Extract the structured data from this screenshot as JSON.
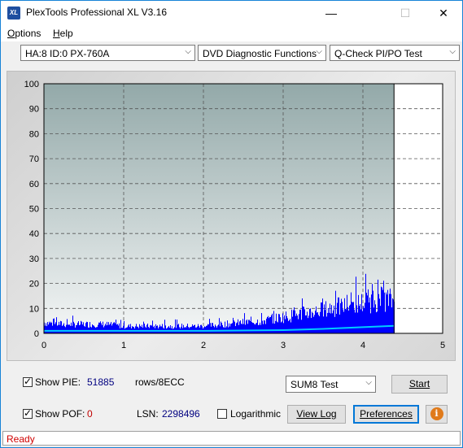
{
  "window": {
    "title": "PlexTools Professional XL V3.16",
    "app_icon": "XL",
    "controls": {
      "minimize": "—",
      "maximize": "☐",
      "close": "✕"
    }
  },
  "menu": {
    "options": "Options",
    "options_key": "O",
    "options_rest": "ptions",
    "help": "Help",
    "help_key": "H",
    "help_rest": "elp"
  },
  "selectors": {
    "drive": "HA:8 ID:0  PX-760A",
    "function": "DVD Diagnostic Functions",
    "test": "Q-Check PI/PO Test"
  },
  "chart_data": {
    "type": "area",
    "title": "",
    "xlabel": "",
    "ylabel": "",
    "xlim": [
      0,
      5
    ],
    "ylim": [
      0,
      100
    ],
    "x_ticks": [
      "0",
      "1",
      "2",
      "3",
      "4",
      "5"
    ],
    "y_ticks": [
      "100",
      "90",
      "80",
      "70",
      "60",
      "50",
      "40",
      "30",
      "20",
      "10",
      "0"
    ],
    "grid": true,
    "data_end_x": 4.39,
    "series": [
      {
        "kind": "PIE bars",
        "color": "#0000ff",
        "x": [
          0.0,
          0.25,
          0.5,
          0.75,
          1.0,
          1.25,
          1.5,
          1.75,
          2.0,
          2.25,
          2.5,
          2.75,
          3.0,
          3.25,
          3.5,
          3.75,
          4.0,
          4.25,
          4.39
        ],
        "values": [
          6,
          5,
          5,
          5,
          4,
          4,
          4,
          4,
          4,
          5,
          6,
          7,
          9,
          11,
          13,
          15,
          17,
          19,
          18
        ]
      },
      {
        "kind": "PIE total (cyan line)",
        "color": "#00ccff",
        "x": [
          0.0,
          1.0,
          2.0,
          3.0,
          3.5,
          4.0,
          4.39
        ],
        "values": [
          1,
          1,
          1,
          1.3,
          1.8,
          2.5,
          3
        ]
      }
    ]
  },
  "controls": {
    "show_pie_label": "Show PIE:",
    "show_pie_checked": true,
    "pie_value": "51885",
    "rows_label": "rows/8ECC",
    "show_pof_label": "Show POF:",
    "show_pof_checked": true,
    "pof_value": "0",
    "lsn_label": "LSN:",
    "lsn_value": "2298496",
    "logarithmic_label": "Logarithmic",
    "logarithmic_checked": false,
    "sum_select": "SUM8 Test",
    "start": "Start",
    "view_log": "View Log",
    "preferences": "Preferences",
    "info_icon": "i"
  },
  "status": {
    "text": "Ready"
  }
}
